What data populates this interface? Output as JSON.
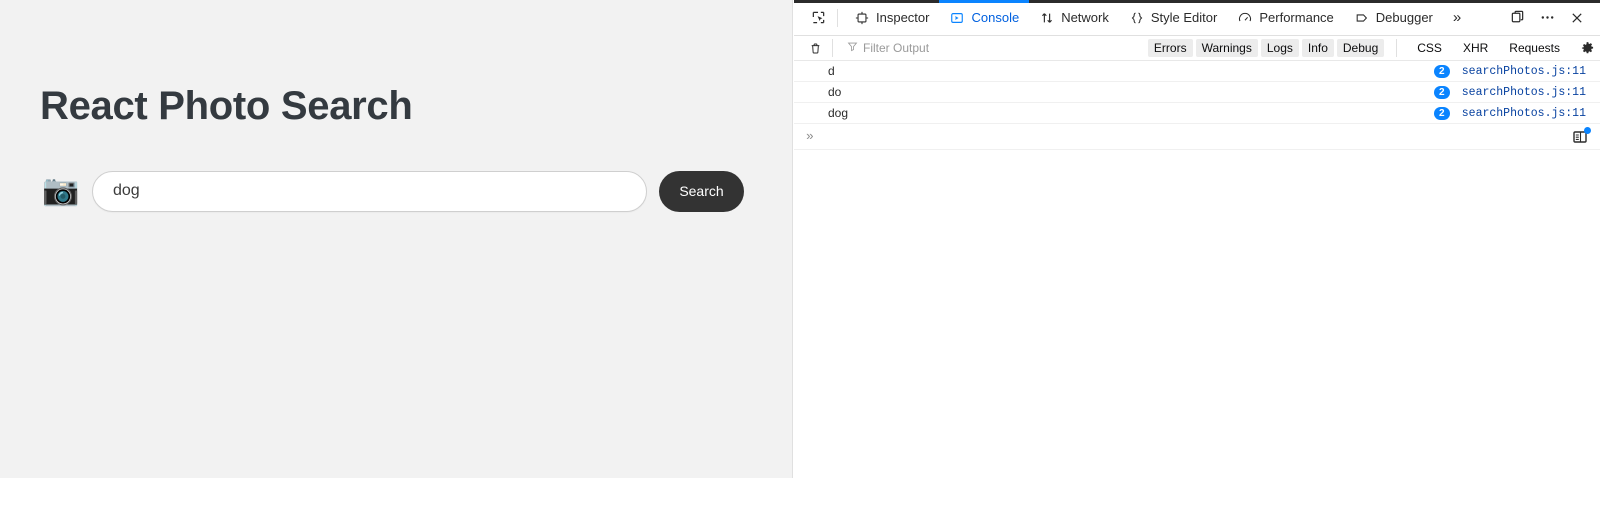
{
  "page": {
    "title": "React Photo Search",
    "camera_icon": "camera-icon",
    "search": {
      "value": "dog",
      "placeholder": "",
      "button_label": "Search"
    }
  },
  "devtools": {
    "toolbar": {
      "picker_icon": "element-picker-icon",
      "tabs": [
        {
          "label": "Inspector",
          "icon": "inspector-icon",
          "active": false
        },
        {
          "label": "Console",
          "icon": "console-icon",
          "active": true
        },
        {
          "label": "Network",
          "icon": "network-icon",
          "active": false
        },
        {
          "label": "Style Editor",
          "icon": "style-editor-icon",
          "active": false
        },
        {
          "label": "Performance",
          "icon": "performance-icon",
          "active": false
        },
        {
          "label": "Debugger",
          "icon": "debugger-icon",
          "active": false
        }
      ],
      "overflow_label": "»",
      "dock_icon": "dock-split-icon",
      "meatball_icon": "more-options-icon",
      "close_icon": "close-icon",
      "active_tab_color": "#0a84ff"
    },
    "filterbar": {
      "trash_icon": "trash-icon",
      "funnel_icon": "funnel-icon",
      "filter_placeholder": "Filter Output",
      "filter_value": "",
      "toggles": [
        {
          "label": "Errors",
          "on": true
        },
        {
          "label": "Warnings",
          "on": true
        },
        {
          "label": "Logs",
          "on": true
        },
        {
          "label": "Info",
          "on": true
        },
        {
          "label": "Debug",
          "on": true
        }
      ],
      "categories": [
        {
          "label": "CSS",
          "on": false
        },
        {
          "label": "XHR",
          "on": false
        },
        {
          "label": "Requests",
          "on": false
        }
      ],
      "gear_icon": "gear-icon"
    },
    "console_logs": [
      {
        "message": "d",
        "count": "2",
        "source": "searchPhotos.js:11"
      },
      {
        "message": "do",
        "count": "2",
        "source": "searchPhotos.js:11"
      },
      {
        "message": "dog",
        "count": "2",
        "source": "searchPhotos.js:11"
      }
    ],
    "prompt": {
      "sign": "»",
      "value": "",
      "editor_icon": "editor-mode-icon"
    },
    "badge_color": "#0a84ff",
    "source_link_color": "#0842a0"
  }
}
